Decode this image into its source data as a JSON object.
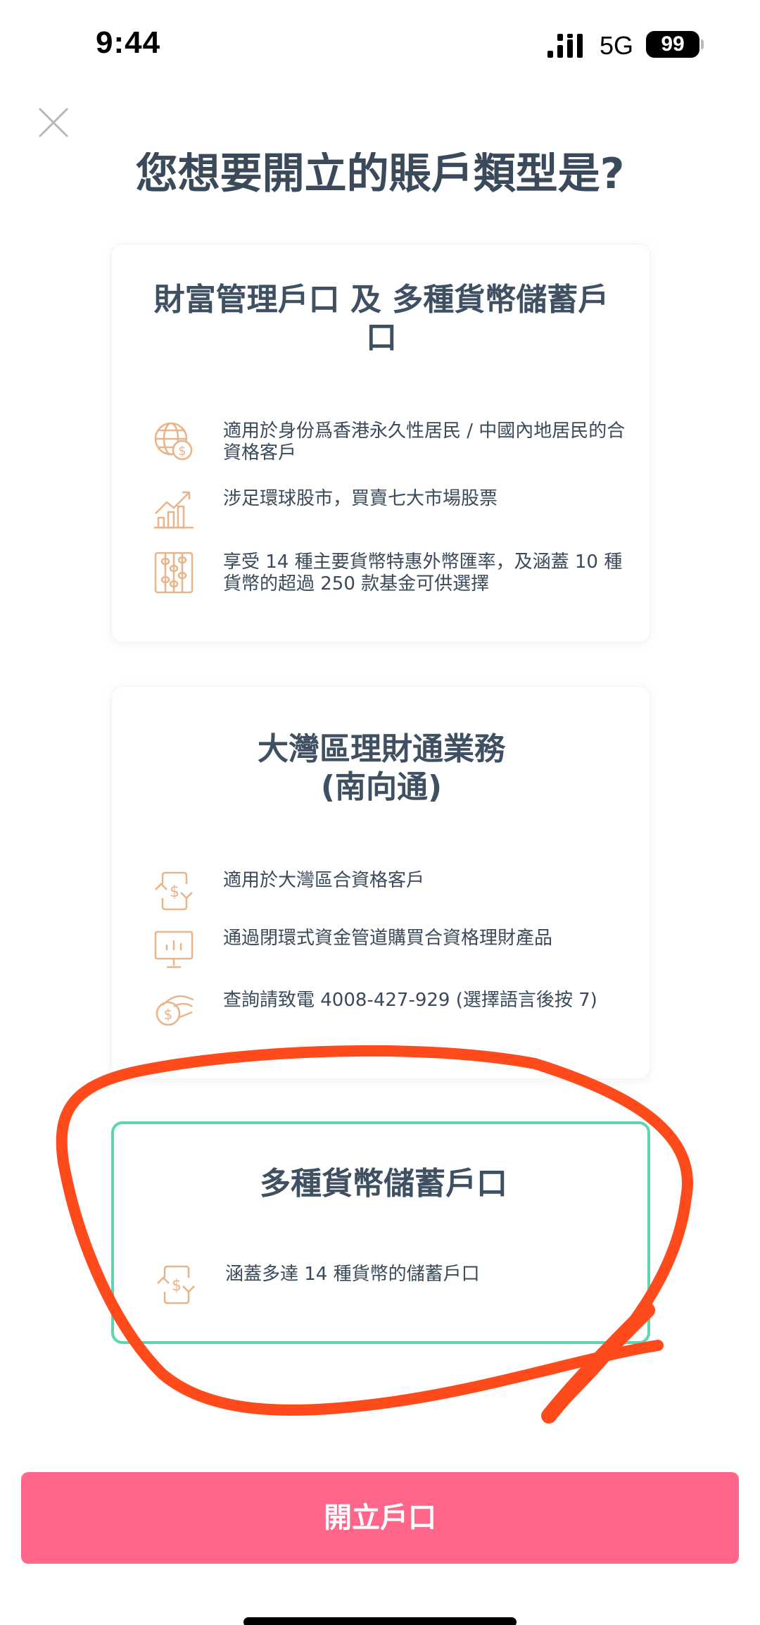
{
  "status_bar": {
    "time": "9:44",
    "network": "5G",
    "battery": "99"
  },
  "page": {
    "heading": "您想要開立的賬戶類型是?"
  },
  "cards": [
    {
      "title": "財富管理戶口 及 多種貨幣儲蓄戶口",
      "features": [
        {
          "icon": "globe-dollar-icon",
          "text": "適用於身份爲香港永久性居民 / 中國內地居民的合資格客戶"
        },
        {
          "icon": "growth-chart-icon",
          "text": "涉足環球股市，買賣七大市場股票"
        },
        {
          "icon": "abacus-icon",
          "text": "享受 14 種主要貨幣特惠外幣匯率，及涵蓋 10 種貨幣的超過 250 款基金可供選擇"
        }
      ]
    },
    {
      "title": "大灣區理財通業務 (南向通)",
      "features": [
        {
          "icon": "currency-exchange-icon",
          "text": "適用於大灣區合資格客戶"
        },
        {
          "icon": "presentation-chart-icon",
          "text": "通過閉環式資金管道購買合資格理財產品"
        },
        {
          "icon": "hand-coin-icon",
          "text": "查詢請致電 4008-427-929 (選擇語言後按 7)"
        }
      ]
    },
    {
      "title": "多種貨幣儲蓄戶口",
      "selected": true,
      "features": [
        {
          "icon": "currency-exchange-icon",
          "text": "涵蓋多達 14 種貨幣的儲蓄戶口"
        }
      ]
    }
  ],
  "button": {
    "label": "開立戶口"
  },
  "colors": {
    "accent_pink": "#ff6689",
    "selected_border": "#5dd6b0",
    "icon_orange": "#e8b48a",
    "annotation_red": "#ff4a1c"
  }
}
